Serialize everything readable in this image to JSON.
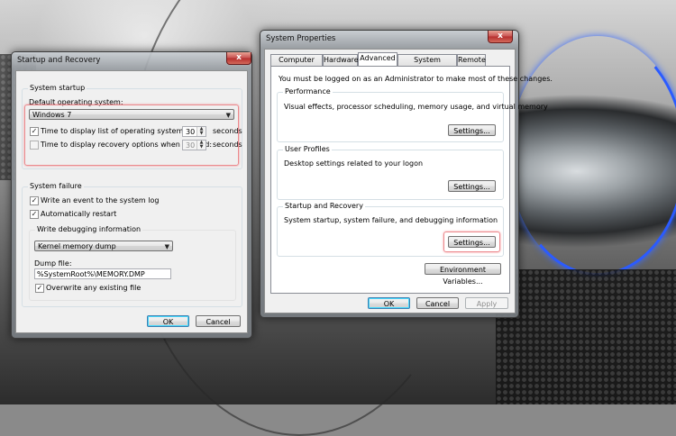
{
  "startup_recovery": {
    "title": "Startup and Recovery",
    "close_label": "x",
    "system_startup": {
      "group_title": "System startup",
      "default_os_label": "Default operating system:",
      "default_os_value": "Windows 7",
      "display_list_label": "Time to display list of operating systems:",
      "display_list_checked": "✓",
      "display_list_value": "30",
      "display_list_units": "seconds",
      "recovery_label": "Time to display recovery options when needed:",
      "recovery_value": "30",
      "recovery_units": "seconds"
    },
    "system_failure": {
      "group_title": "System failure",
      "write_event_label": "Write an event to the system log",
      "write_event_checked": "✓",
      "auto_restart_label": "Automatically restart",
      "auto_restart_checked": "✓",
      "debug_group_title": "Write debugging information",
      "debug_type_value": "Kernel memory dump",
      "dump_file_label": "Dump file:",
      "dump_file_value": "%SystemRoot%\\MEMORY.DMP",
      "overwrite_label": "Overwrite any existing file",
      "overwrite_checked": "✓"
    },
    "ok_label": "OK",
    "cancel_label": "Cancel"
  },
  "system_properties": {
    "title": "System Properties",
    "close_label": "x",
    "tabs": [
      {
        "label": "Computer Name"
      },
      {
        "label": "Hardware"
      },
      {
        "label": "Advanced"
      },
      {
        "label": "System Protection"
      },
      {
        "label": "Remote"
      }
    ],
    "admin_note": "You must be logged on as an Administrator to make most of these changes.",
    "performance": {
      "title": "Performance",
      "description": "Visual effects, processor scheduling, memory usage, and virtual memory",
      "settings_label": "Settings..."
    },
    "user_profiles": {
      "title": "User Profiles",
      "description": "Desktop settings related to your logon",
      "settings_label": "Settings..."
    },
    "startup_recovery": {
      "title": "Startup and Recovery",
      "description": "System startup, system failure, and debugging information",
      "settings_label": "Settings..."
    },
    "env_vars_label": "Environment Variables...",
    "ok_label": "OK",
    "cancel_label": "Cancel",
    "apply_label": "Apply"
  },
  "colors": {
    "highlight": "#ec8a8e",
    "accent_blue": "#2b5bff"
  }
}
